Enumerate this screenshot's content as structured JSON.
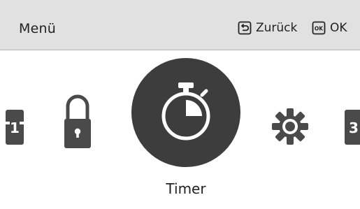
{
  "header": {
    "title": "Menü",
    "back_label": "Zurück",
    "ok_label": "OK",
    "ok_icon_text": "OK"
  },
  "carousel": {
    "items": [
      {
        "name": "previous-item",
        "icon": "digit-icon",
        "edge_text": "1"
      },
      {
        "name": "lock",
        "icon": "lock-icon"
      },
      {
        "name": "timer",
        "icon": "stopwatch-icon",
        "selected": true
      },
      {
        "name": "settings",
        "icon": "gear-icon"
      },
      {
        "name": "next-item",
        "icon": "digit-icon",
        "edge_text": "3"
      }
    ],
    "selected_label": "Timer"
  },
  "colors": {
    "header_bg": "#e1e1e1",
    "icon_gray": "#4a4a4a",
    "selected_bg": "#3d3d3d",
    "selected_fg": "#ffffff",
    "text": "#222222"
  }
}
